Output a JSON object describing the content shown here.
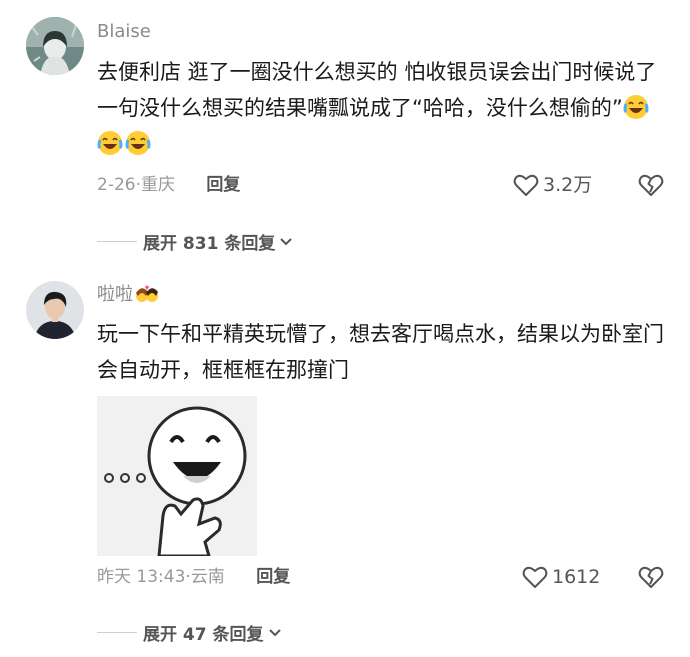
{
  "comments": [
    {
      "username": "Blaise",
      "text": "去便利店 逛了一圈没什么想买的 怕收银员误会出门时候说了一句没什么想买的结果嘴瓢说成了“哈哈，没什么想偷的”",
      "emojis": [
        "laughing-crying-emoji",
        "laughing-crying-emoji",
        "laughing-crying-emoji"
      ],
      "date": "2-26",
      "location": "重庆",
      "reply_label": "回复",
      "likes": "3.2万",
      "expand_label": "展开 831 条回复"
    },
    {
      "username": "啦啦",
      "username_emoji": "couple-kiss-emoji",
      "text": "玩一下午和平精英玩懵了，想去客厅喝点水，结果以为卧室门会自动开，框框框在那撞门",
      "sticker": "smiling-face-thinking-sticker",
      "date": "昨天 13:43",
      "location": "云南",
      "reply_label": "回复",
      "likes": "1612",
      "expand_label": "展开 47 条回复"
    }
  ],
  "separator": "·"
}
